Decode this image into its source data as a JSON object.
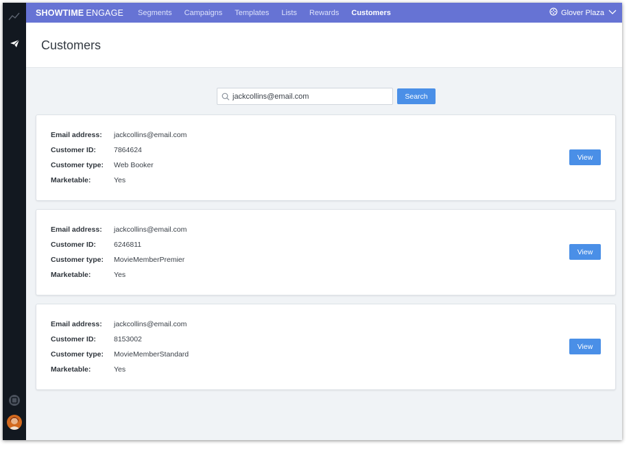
{
  "brand": {
    "bold": "SHOWTIME",
    "light": "ENGAGE"
  },
  "nav": [
    "Segments",
    "Campaigns",
    "Templates",
    "Lists",
    "Rewards",
    "Customers"
  ],
  "nav_active": "Customers",
  "venue": "Glover Plaza",
  "page_title": "Customers",
  "search": {
    "value": "jackcollins@email.com",
    "button": "Search"
  },
  "field_labels": {
    "email": "Email address:",
    "id": "Customer ID:",
    "type": "Customer type:",
    "marketable": "Marketable:"
  },
  "customers": [
    {
      "email": "jackcollins@email.com",
      "id": "7864624",
      "type": "Web Booker",
      "marketable": "Yes",
      "action": "View"
    },
    {
      "email": "jackcollins@email.com",
      "id": "6246811",
      "type": "MovieMemberPremier",
      "marketable": "Yes",
      "action": "View"
    },
    {
      "email": "jackcollins@email.com",
      "id": "8153002",
      "type": "MovieMemberStandard",
      "marketable": "Yes",
      "action": "View"
    }
  ],
  "colors": {
    "topbar": "#6673d4",
    "rail": "#121820",
    "primary_button": "#4a8fe7",
    "page_bg": "#f0f3f6"
  },
  "icons": [
    "analytics-icon",
    "send-icon",
    "help-icon",
    "avatar",
    "search-icon",
    "venue-icon",
    "chevron-down-icon"
  ]
}
